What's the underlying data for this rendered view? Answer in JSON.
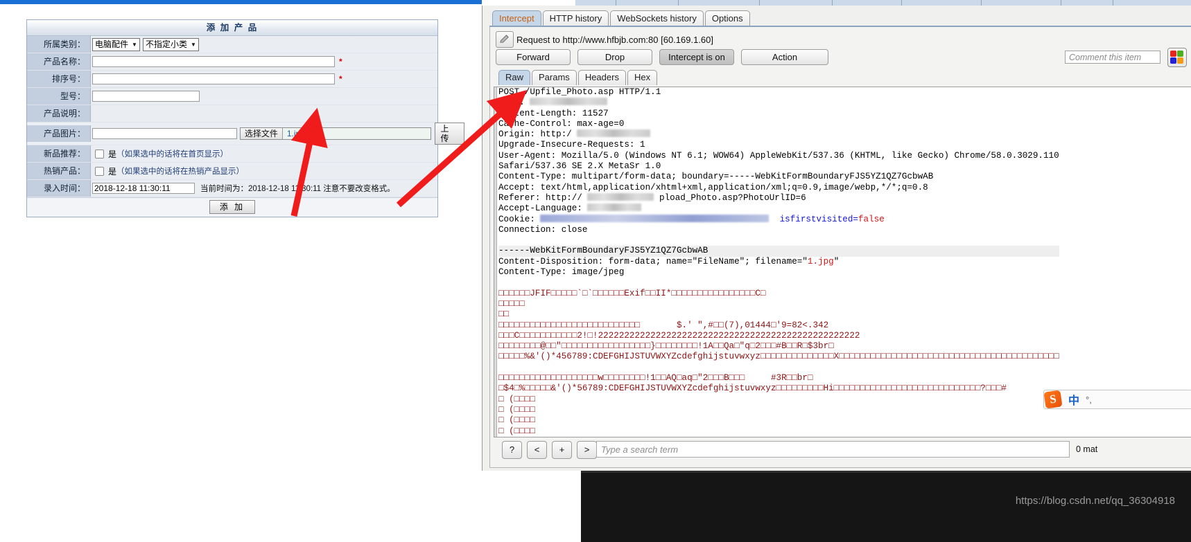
{
  "browser": {
    "watermark": "https://blog.csdn.net/qq_36304918"
  },
  "product_form": {
    "title": "添 加 产 品",
    "rows": {
      "category_label": "所属类别：",
      "category_main": "电脑配件",
      "category_sub": "不指定小类",
      "name_label": "产品名称：",
      "name_value": "",
      "sort_label": "排序号：",
      "sort_value": "",
      "model_label": "型号：",
      "model_value": "",
      "desc_label": "产品说明：",
      "image_label": "产品图片：",
      "image_path_value": "",
      "choose_file_button": "选择文件",
      "chosen_file_name": "1.jpg",
      "upload_button": "上 传",
      "new_rec_label": "新品推荐：",
      "new_rec_yes": "是",
      "new_rec_hint": "（如果选中的话将在首页显示）",
      "hot_label": "热销产品：",
      "hot_yes": "是",
      "hot_hint": "（如果选中的话将在热销产品显示）",
      "time_label": "录入时间：",
      "time_value": "2018-12-18 11:30:11",
      "time_hint": "当前时间为：2018-12-18 11:30:11 注意不要改变格式。"
    },
    "submit_button": "添 加",
    "required_mark": "*"
  },
  "burp": {
    "main_tabs": [
      {
        "label": "Intercept",
        "active": true
      },
      {
        "label": "HTTP history",
        "active": false
      },
      {
        "label": "WebSockets history",
        "active": false
      },
      {
        "label": "Options",
        "active": false
      }
    ],
    "request_title": "Request to http://www.hfbjb.com:80  [60.169.1.60]",
    "action_buttons": [
      {
        "label": "Forward",
        "pressed": false
      },
      {
        "label": "Drop",
        "pressed": false
      },
      {
        "label": "Intercept is on",
        "pressed": true
      },
      {
        "label": "Action",
        "pressed": false
      }
    ],
    "comment_placeholder": "Comment this item",
    "color_swatches": [
      "#e8241c",
      "#4caf1e",
      "#2222d8",
      "#f49a14"
    ],
    "sub_tabs": [
      {
        "label": "Raw",
        "active": true
      },
      {
        "label": "Params",
        "active": false
      },
      {
        "label": "Headers",
        "active": false
      },
      {
        "label": "Hex",
        "active": false
      }
    ],
    "search": {
      "help_button": "?",
      "prev_button": "<",
      "add_button": "+",
      "next_button": ">",
      "placeholder": "Type a search term",
      "match_count": "0 mat"
    }
  },
  "raw_request": {
    "request_line": "POST /Upfile_Photo.asp HTTP/1.1",
    "headers": [
      {
        "name": "Host:",
        "redacted": true,
        "redact_width": 112
      },
      {
        "name": "Content-Length:",
        "value": " 11527"
      },
      {
        "name": "Cache-Control:",
        "value": " max-age=0"
      },
      {
        "name": "Origin:",
        "value": " http:/",
        "redacted": true,
        "redact_width": 106
      },
      {
        "name": "Upgrade-Insecure-Requests:",
        "value": " 1"
      },
      {
        "name": "User-Agent:",
        "value": " Mozilla/5.0 (Windows NT 6.1; WOW64) AppleWebKit/537.36 (KHTML, like Gecko) Chrome/58.0.3029.110 Safari/537.36 SE 2.X MetaSr 1.0"
      },
      {
        "name": "Content-Type:",
        "value": " multipart/form-data; boundary=-----WebKitFormBoundaryFJS5YZ1QZ7GcbwAB"
      },
      {
        "name": "Accept:",
        "value": " text/html,application/xhtml+xml,application/xml;q=0.9,image/webp,*/*;q=0.8"
      },
      {
        "name": "Referer:",
        "value": " http://",
        "redacted": true,
        "redact_width": 96,
        "tail": "pload_Photo.asp?PhotoUrlID=6"
      },
      {
        "name": "Accept-Language:",
        "redacted": true,
        "redact_width": 78
      },
      {
        "name": "Cookie:",
        "redacted": true,
        "redact_width": 330,
        "tail_blue": "isfirstvisited",
        "tail_eq": "=",
        "tail_red": "false"
      },
      {
        "name": "Connection:",
        "value": " close"
      }
    ],
    "boundary_line": "------WebKitFormBoundaryFJS5YZ1QZ7GcbwAB",
    "content_disposition_prefix": "Content-Disposition: form-data; name=\"FileName\"; filename=\"",
    "content_disposition_filename": "1.jpg",
    "content_disposition_suffix": "\"",
    "content_type_part": "Content-Type: image/jpeg",
    "binary_lines": [
      "ÿØÿà\u0000\u0010JFIF\u0000\u0001\u0001\u0001\u0000`\u0000`\u0000\u0000ÿá\u0000\u0016Exif\u0000\u0000II*\u0000\b\u0000\u0000\u0000\u0000\u0000\u0000\u0000\u0000\u0000\u0000\u0000ÿÛ\u0000C\u0000",
      "\b\u0006\u0006\u0007\u0006",
      "\u0005\b",
      "\u0007\u0007\u0007\t\t\b\n\f\u0014\r\f\u000b\u000b\f\u0019\u0012\u0013\u000f\u0014\u001d\u001a\u001f\u001e\u001d\u001a\u001c\u001c       $.' \",#\u001c\u001c(7),01444\u001f'9=82<.342",
      "ÿÛ\u0000C\u0001\t\t\t\f\u000b\f\u0018\r\r\u00182!\u001c!22222222222222222222222222222222222222222222222222",
      "ÿÀ\u0000\u0011\b\u0000Ð\u0001@\u0003\u0001\"\u0000\u0002\u0011\u0001\u0003\u0011\u0001ÿÄ\u0000\u001f\u0000\u0000\u0001\u0005\u0001\u0001}\u0001\u0002\u0003\u0000\u0004\u0011\u0005\u0012!1A\u0006\u0013Qa\u0007\"q\u00142¡#B±ÁRÑ$3br",
      "\t\n\u0016\u0017\u0018%&'()*456789:CDEFGHIJSTUVWXYZcdefghijstuvwxyzX¢£¤¥¦§¨©ª²³´µ¶·¸¹ºÂÃÄÅÆÇÈÉÊÒÓÔÕÖ×ØÙÚáâã",
      "",
      "ÿÄ\u0000\u001f\u0001\u0000\u0003\u0001\u0001\u0001\u0001\u0001\u0001\u0001\u0001\u0001\u0000\u0000\u0000w\u0000\u0001\u0002\u0003\u0004\u0005\u0006\u0007!1\u0011\u0012AQ\u0007aq\u0013\"2\b\u0014B¡±     #3Rð\u0015brÑ",
      "\u0016$4Ñ%ñ\u0017\u0018\u0019\u001a&'()*56789:CDEFGHIJSTUVWXYZcdefghijstuvwxyzHi¢£¤¥¦§¨©ª²³´µ¶·¸¹ºÂ?ÃÄÅ#",
      "\u000e (\u0002\u0001\u0002",
      "\u000e (\u0002\u0001\u0002",
      "\u000e (\u0002\u0001\u0002",
      "\u000e (\u0002\u0001\u0002",
      "\u000e (\u0002\u0001\u0002",
      "\u000e (\u0002\u0001\u0002"
    ]
  }
}
